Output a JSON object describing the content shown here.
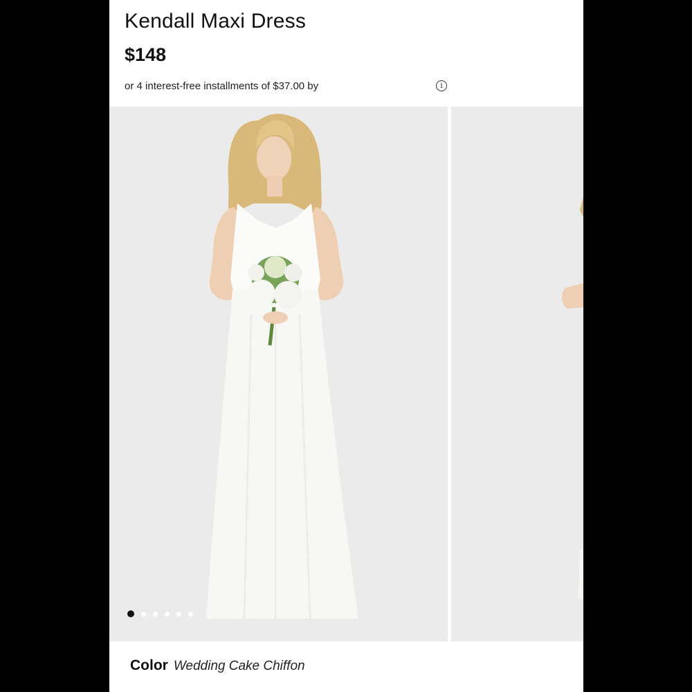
{
  "product": {
    "title": "Kendall Maxi Dress",
    "price": "$148",
    "installments_text": "or 4 interest-free installments of $37.00 by",
    "info_icon": "info-circle-icon"
  },
  "gallery": {
    "image_count": 6,
    "active_index": 0
  },
  "color": {
    "label": "Color",
    "value": "Wedding Cake Chiffon"
  }
}
